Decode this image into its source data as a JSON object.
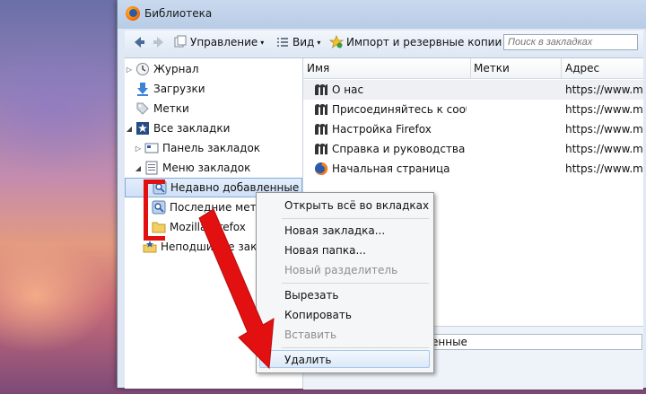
{
  "window": {
    "title": "Библиотека"
  },
  "toolbar": {
    "manage": "Управление",
    "view": "Вид",
    "import": "Импорт и резервные копии",
    "search_placeholder": "Поиск в закладках"
  },
  "sidebar": {
    "items": [
      {
        "label": "Журнал",
        "icon": "history-clock-icon"
      },
      {
        "label": "Загрузки",
        "icon": "download-arrow-icon"
      },
      {
        "label": "Метки",
        "icon": "tag-icon"
      },
      {
        "label": "Все закладки",
        "icon": "bookmarks-star-icon"
      },
      {
        "label": "Панель закладок",
        "icon": "bookmarks-toolbar-icon"
      },
      {
        "label": "Меню закладок",
        "icon": "bookmarks-menu-icon"
      },
      {
        "label": "Недавно добавленные",
        "icon": "smart-folder-icon"
      },
      {
        "label": "Последние метк",
        "icon": "smart-folder-icon"
      },
      {
        "label": "Mozilla Firefox",
        "icon": "folder-icon"
      },
      {
        "label": "Неподшитые закладки",
        "icon": "unsorted-bookmarks-icon"
      }
    ]
  },
  "main": {
    "columns": [
      "Имя",
      "Метки",
      "Адрес"
    ],
    "rows": [
      {
        "name": "О нас",
        "address": "https://www.m"
      },
      {
        "name": "Присоединяйтесь к сооб...",
        "address": "https://www.m"
      },
      {
        "name": "Настройка Firefox",
        "address": "https://www.m"
      },
      {
        "name": "Справка и руководства",
        "address": "https://www.m"
      },
      {
        "name": "Начальная страница",
        "address": "https://www.m"
      }
    ]
  },
  "details": {
    "field_value": "енные"
  },
  "context_menu": {
    "open_all": "Открыть всё во вкладках",
    "new_bookmark": "Новая закладка...",
    "new_folder": "Новая папка...",
    "new_separator": "Новый разделитель",
    "cut": "Вырезать",
    "copy": "Копировать",
    "paste": "Вставить",
    "delete": "Удалить"
  },
  "colors": {
    "annotation_red": "#e21010",
    "selection_blue": "#84acdd"
  }
}
